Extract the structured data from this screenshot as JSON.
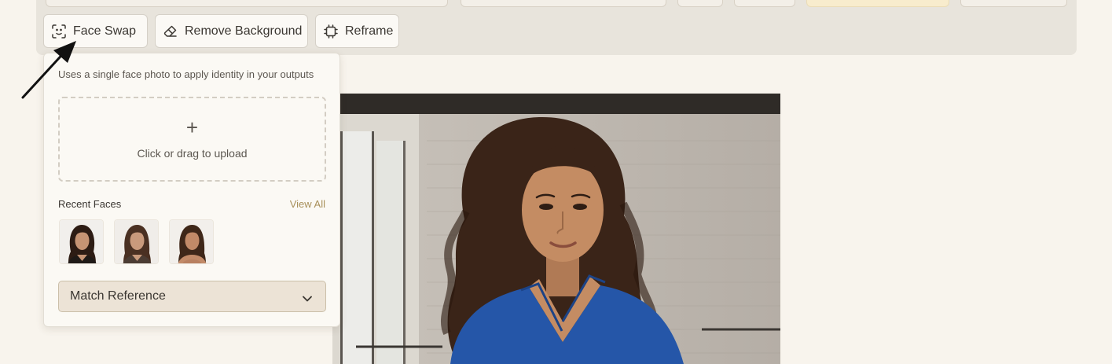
{
  "toolbar": {
    "buttons": [
      {
        "label": "Face Swap",
        "icon": "face-scan-icon"
      },
      {
        "label": "Remove Background",
        "icon": "eraser-icon"
      },
      {
        "label": "Reframe",
        "icon": "reframe-icon"
      }
    ]
  },
  "face_swap_panel": {
    "description": "Uses a single face photo to apply identity in your outputs",
    "upload": {
      "icon": "plus-icon",
      "text": "Click or drag to upload"
    },
    "recent_faces_title": "Recent Faces",
    "view_all_label": "View All",
    "recent_faces_count": 3,
    "select": {
      "value": "Match Reference",
      "icon": "chevron-down-icon"
    }
  },
  "colors": {
    "page_bg": "#f8f4ed",
    "toolbar_bg": "#e8e4dc",
    "accent": "#a8905a",
    "select_bg": "#ece3d6"
  }
}
